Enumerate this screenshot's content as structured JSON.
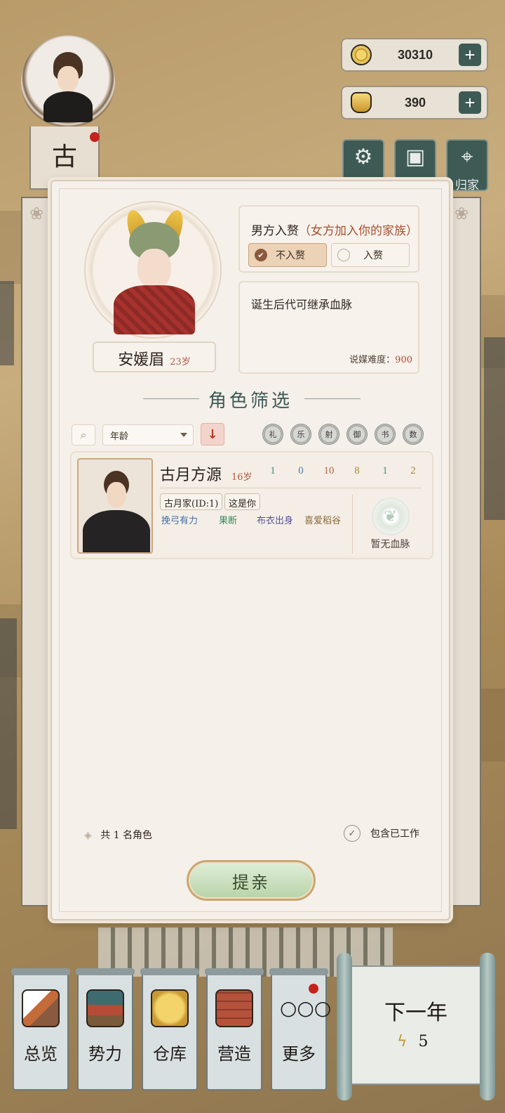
{
  "player": {
    "name_char": "古"
  },
  "currency": {
    "coins": "30310",
    "gold": "390",
    "add": "+"
  },
  "system_buttons": [
    {
      "label": "设置",
      "icon": "gear-icon"
    },
    {
      "label": "保存",
      "icon": "save-icon"
    },
    {
      "label": "归家",
      "icon": "location-pin-icon"
    }
  ],
  "candidate": {
    "name": "安媛眉",
    "age": "23岁"
  },
  "marriage_type": {
    "title": "男方入赘",
    "subtitle": "（女方加入你的家族）",
    "options": [
      "不入赘",
      "入赘"
    ],
    "selected": 0
  },
  "description": {
    "text": "诞生后代可继承血脉",
    "difficulty_label": "说媒难度：",
    "difficulty_value": "900"
  },
  "section_title": "角色筛选",
  "filter": {
    "sort_by": "年龄",
    "sort_dir": "↓",
    "attributes": [
      "礼",
      "乐",
      "射",
      "御",
      "书",
      "数"
    ]
  },
  "characters": [
    {
      "name": "古月方源",
      "age": "16岁",
      "stats": [
        {
          "value": "1",
          "color": "#4f8a7a"
        },
        {
          "value": "0",
          "color": "#4c7aa8"
        },
        {
          "value": "10",
          "color": "#b0643e"
        },
        {
          "value": "8",
          "color": "#a88a3a"
        },
        {
          "value": "1",
          "color": "#4f8a7a"
        },
        {
          "value": "2",
          "color": "#a88a3a"
        }
      ],
      "tags": [
        "古月家(ID:1)",
        "这是你"
      ],
      "traits": [
        {
          "text": "挽弓有力",
          "color": "#3f6ea8"
        },
        {
          "text": "果断",
          "color": "#3c8a5e"
        },
        {
          "text": "布衣出身",
          "color": "#5a4f98"
        },
        {
          "text": "喜爱稻谷",
          "color": "#8a6a3e"
        }
      ],
      "bloodline": "暂无血脉"
    }
  ],
  "footer": {
    "count_prefix": "共",
    "count": "1",
    "count_suffix": "名角色",
    "include_working": "包含已工作"
  },
  "propose_button": "提亲",
  "bottom_nav": [
    {
      "label": "总览",
      "icon": "overview-icon"
    },
    {
      "label": "势力",
      "icon": "faction-icon"
    },
    {
      "label": "仓库",
      "icon": "storage-icon"
    },
    {
      "label": "营造",
      "icon": "build-icon"
    },
    {
      "label": "更多",
      "icon": "more-icon",
      "glyph": "○○○"
    }
  ],
  "next_year": {
    "label": "下一年",
    "energy": "5"
  }
}
